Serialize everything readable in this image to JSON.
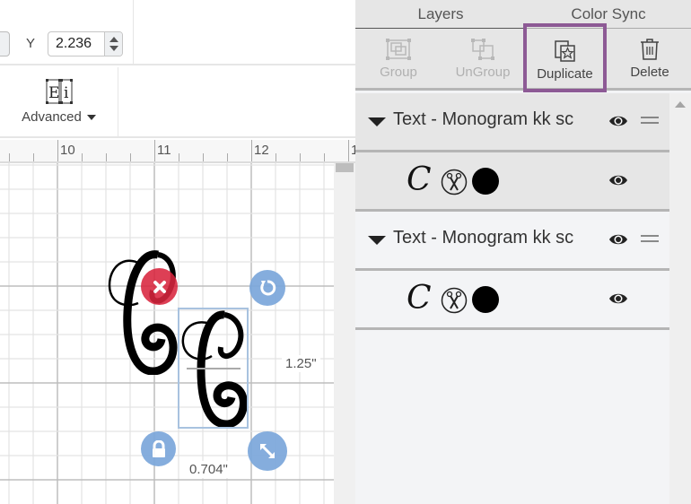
{
  "toolbar": {
    "y_label": "Y",
    "y_value": "2.236",
    "advanced_label": "Advanced"
  },
  "ruler": {
    "labels": [
      "10",
      "11",
      "12",
      "1"
    ]
  },
  "canvas": {
    "height_label": "1.25\"",
    "width_label": "0.704\"",
    "glyph": "C"
  },
  "panel": {
    "tabs": [
      {
        "label": "Layers",
        "active": true
      },
      {
        "label": "Color Sync",
        "active": false
      }
    ],
    "actions": [
      {
        "label": "Group",
        "enabled": false,
        "icon": "group-icon"
      },
      {
        "label": "UnGroup",
        "enabled": false,
        "icon": "ungroup-icon"
      },
      {
        "label": "Duplicate",
        "enabled": true,
        "highlighted": true,
        "icon": "duplicate-icon"
      },
      {
        "label": "Delete",
        "enabled": true,
        "icon": "trash-icon"
      }
    ],
    "layers": [
      {
        "title": "Text - Monogram kk sc",
        "glyph": "C",
        "operation": "cut",
        "color": "#000000"
      },
      {
        "title": "Text - Monogram kk sc",
        "glyph": "C",
        "operation": "cut",
        "color": "#000000"
      }
    ],
    "highlight_color": "#8d5a95"
  }
}
